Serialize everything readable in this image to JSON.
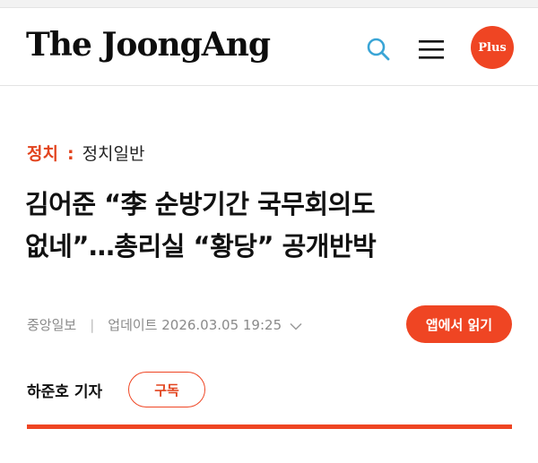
{
  "header": {
    "logo_text": "The JoongAng",
    "search_icon": "search-icon",
    "menu_icon": "hamburger-menu-icon",
    "plus_label": "Plus"
  },
  "breadcrumb": {
    "section": "정치",
    "separator": ":",
    "subsection": "정치일반"
  },
  "article": {
    "headline_lines": [
      "김어준 “李 순방기간 국무회의도",
      "없네”…총리실 “황당” 공개반박"
    ],
    "source": "중앙일보",
    "divider": "|",
    "updated": "업데이트 2026.03.05 19:25",
    "open_in_app_label": "앱에서 읽기",
    "reporter": "하준호 기자",
    "subscribe_label": "구독"
  },
  "colors": {
    "accent": "#ef4523",
    "section_text": "#e2431d",
    "search_icon": "#3aa5d6",
    "text": "#111111",
    "muted": "#8a8a8a"
  }
}
